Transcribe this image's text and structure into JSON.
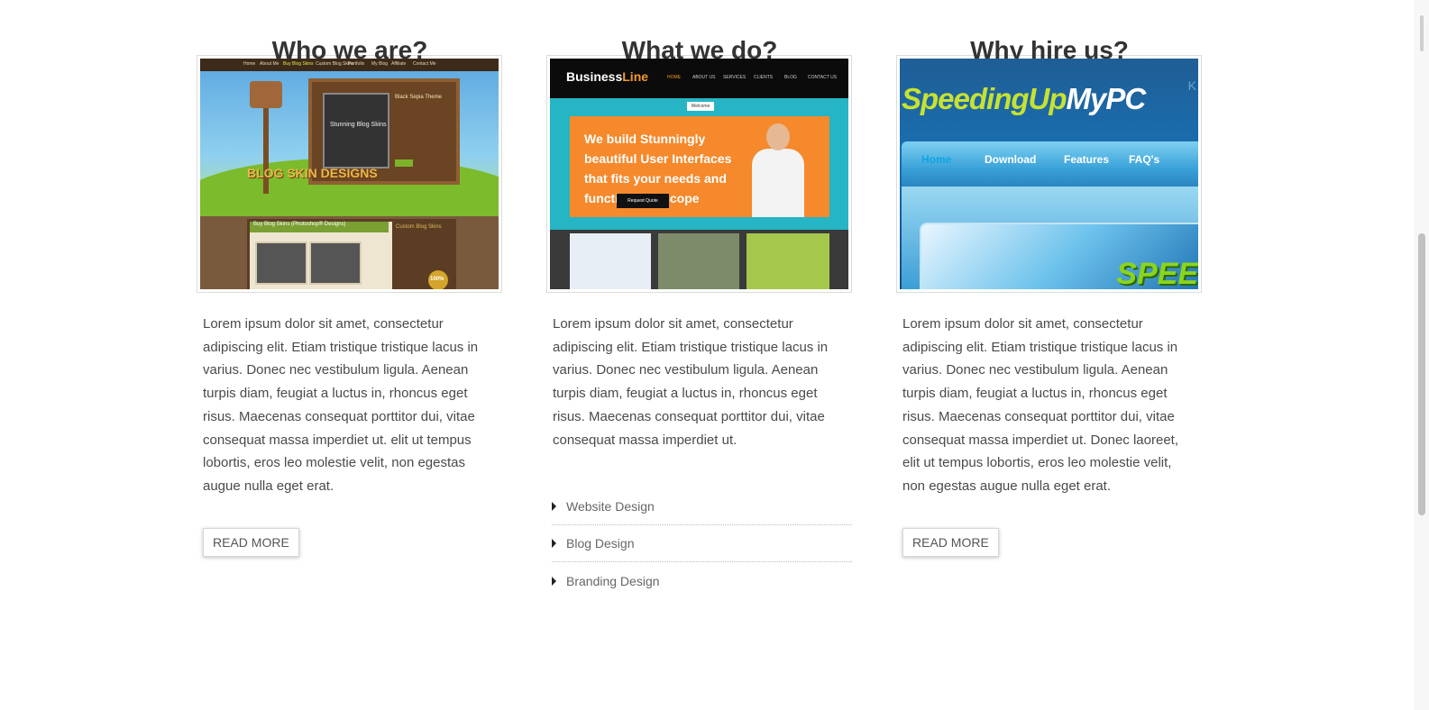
{
  "columns": [
    {
      "title": "Who we are?",
      "paragraph": "Lorem ipsum dolor sit amet, consectetur adipiscing elit. Etiam tristique tristique lacus in varius. Donec nec vestibulum ligula. Aenean turpis diam, feugiat a luctus in, rhoncus eget risus. Maecenas consequat porttitor dui, vitae consequat massa imperdiet ut. elit ut tempus lobortis, eros leo molestie velit, non egestas augue nulla eget erat.",
      "button": "READ MORE",
      "screenshot": {
        "nav": [
          "Home",
          "About Me",
          "Buy Blog Skins",
          "Custom Blog Skins",
          "Portfolio",
          "My Blog",
          "Affiliate",
          "Contact Me"
        ],
        "board_title": "Black Sepia Theme",
        "screen_text": "Stunning Blog Skins",
        "logo": "BLOG SKIN DESIGNS",
        "panel_heading": "Buy Blog Skins (Photoshop® Designs)",
        "side_heading": "Custom Blog Skins",
        "badge": "100%"
      }
    },
    {
      "title": "What we do?",
      "paragraph": "Lorem ipsum dolor sit amet, consectetur adipiscing elit. Etiam tristique tristique lacus in varius. Donec nec vestibulum ligula. Aenean turpis diam, feugiat a luctus in, rhoncus eget risus. Maecenas consequat porttitor dui, vitae consequat massa imperdiet ut.",
      "list": [
        "Website Design",
        "Blog Design",
        "Branding Design"
      ],
      "screenshot": {
        "logo_a": "Business",
        "logo_b": "Line",
        "nav": [
          "HOME",
          "ABOUT US",
          "SERVICES",
          "CLIENTS",
          "BLOG",
          "CONTACT US"
        ],
        "tab": "Welcome",
        "headline": "We build Stunningly beautiful User Interfaces that fits your needs and functionality scope",
        "cta": "Request Quote"
      }
    },
    {
      "title": "Why hire us?",
      "paragraph": "Lorem ipsum dolor sit amet, consectetur adipiscing elit. Etiam tristique tristique lacus in varius. Donec nec vestibulum ligula. Aenean turpis diam, feugiat a luctus in, rhoncus eget risus. Maecenas consequat porttitor dui, vitae consequat massa imperdiet ut. Donec laoreet, elit ut tempus lobortis, eros leo molestie velit, non egestas augue nulla eget erat.",
      "button": "READ MORE",
      "screenshot": {
        "logo_a": "SpeedingUp",
        "logo_b": "MyPC",
        "corner": "K",
        "nav": [
          "Home",
          "Download",
          "Features",
          "FAQ's"
        ],
        "banner": "SPEE"
      }
    }
  ]
}
